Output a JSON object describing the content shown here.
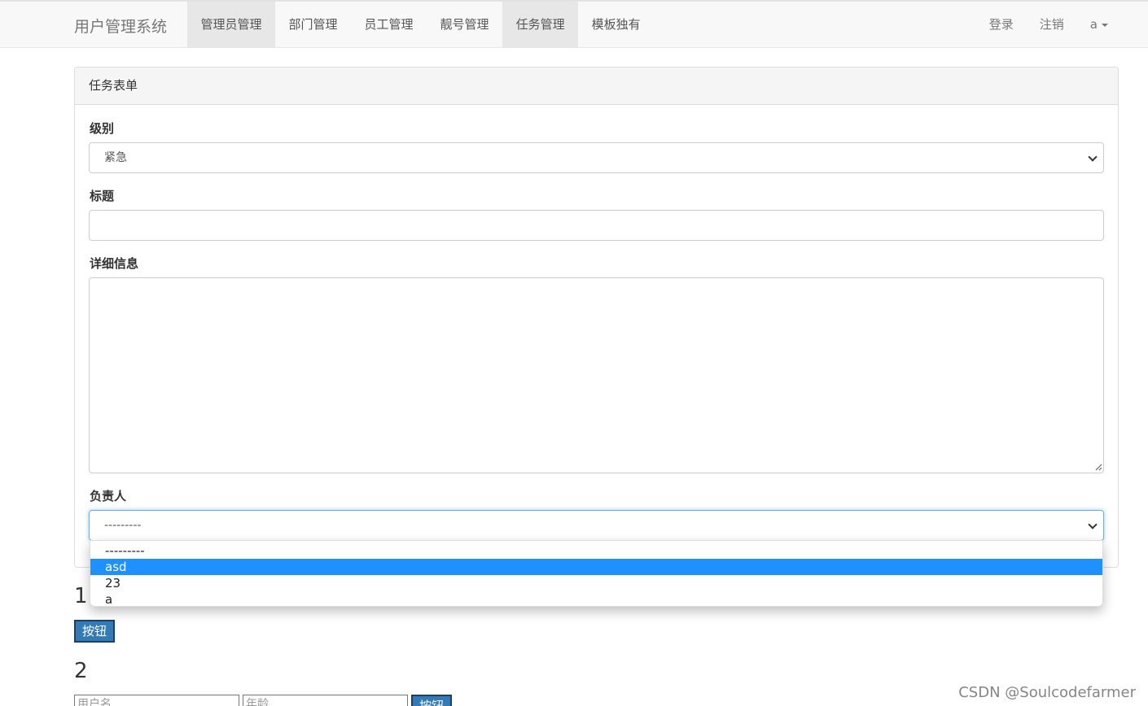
{
  "navbar": {
    "brand": "用户管理系统",
    "items": [
      "管理员管理",
      "部门管理",
      "员工管理",
      "靓号管理",
      "任务管理",
      "模板独有"
    ],
    "right": {
      "login": "登录",
      "logout": "注销",
      "user": "a"
    }
  },
  "panel": {
    "title": "任务表单",
    "level_label": "级别",
    "level_value": "紧急",
    "title_label": "标题",
    "title_value": "",
    "detail_label": "详细信息",
    "detail_value": "",
    "owner_label": "负责人",
    "owner_value": "---------"
  },
  "dropdown": {
    "options": [
      "---------",
      "asd",
      "23",
      "a"
    ],
    "highlighted": "asd"
  },
  "section1": {
    "number": "1",
    "button": "按钮"
  },
  "section2": {
    "number": "2",
    "username_placeholder": "用户名",
    "age_placeholder": "年龄",
    "button": "按钮"
  },
  "watermark": "CSDN @Soulcodefarmer",
  "colors": {
    "highlight": "#1e90ff",
    "button": "#337ab7"
  }
}
